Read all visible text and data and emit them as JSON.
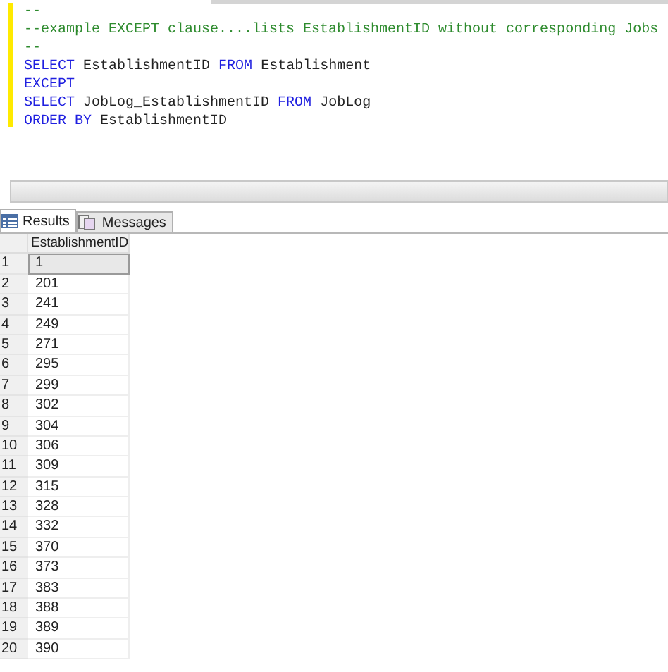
{
  "editor": {
    "lines": [
      [
        {
          "kind": "comment",
          "text": "--"
        }
      ],
      [
        {
          "kind": "comment",
          "text": "--example EXCEPT clause....lists EstablishmentID without corresponding Jobs"
        }
      ],
      [
        {
          "kind": "comment",
          "text": "--"
        }
      ],
      [
        {
          "kind": "keyword",
          "text": "SELECT"
        },
        {
          "kind": "plain",
          "text": " EstablishmentID "
        },
        {
          "kind": "keyword",
          "text": "FROM"
        },
        {
          "kind": "plain",
          "text": " Establishment"
        }
      ],
      [
        {
          "kind": "keyword",
          "text": "EXCEPT"
        }
      ],
      [
        {
          "kind": "keyword",
          "text": "SELECT"
        },
        {
          "kind": "plain",
          "text": " JobLog_EstablishmentID "
        },
        {
          "kind": "keyword",
          "text": "FROM"
        },
        {
          "kind": "plain",
          "text": " JobLog"
        }
      ],
      [
        {
          "kind": "keyword",
          "text": "ORDER BY"
        },
        {
          "kind": "plain",
          "text": " EstablishmentID"
        }
      ]
    ]
  },
  "tabs": [
    {
      "label": "Results",
      "kind": "grid",
      "selected": true
    },
    {
      "label": "Messages",
      "kind": "messages",
      "selected": false
    }
  ],
  "grid": {
    "columns": [
      "EstablishmentID"
    ],
    "rows": [
      {
        "number": "1",
        "value": "1",
        "selected": true
      },
      {
        "number": "2",
        "value": "201",
        "selected": false
      },
      {
        "number": "3",
        "value": "241",
        "selected": false
      },
      {
        "number": "4",
        "value": "249",
        "selected": false
      },
      {
        "number": "5",
        "value": "271",
        "selected": false
      },
      {
        "number": "6",
        "value": "295",
        "selected": false
      },
      {
        "number": "7",
        "value": "299",
        "selected": false
      },
      {
        "number": "8",
        "value": "302",
        "selected": false
      },
      {
        "number": "9",
        "value": "304",
        "selected": false
      },
      {
        "number": "10",
        "value": "306",
        "selected": false
      },
      {
        "number": "11",
        "value": "309",
        "selected": false
      },
      {
        "number": "12",
        "value": "315",
        "selected": false
      },
      {
        "number": "13",
        "value": "328",
        "selected": false
      },
      {
        "number": "14",
        "value": "332",
        "selected": false
      },
      {
        "number": "15",
        "value": "370",
        "selected": false
      },
      {
        "number": "16",
        "value": "373",
        "selected": false
      },
      {
        "number": "17",
        "value": "383",
        "selected": false
      },
      {
        "number": "18",
        "value": "388",
        "selected": false
      },
      {
        "number": "19",
        "value": "389",
        "selected": false
      },
      {
        "number": "20",
        "value": "390",
        "selected": false
      }
    ]
  }
}
